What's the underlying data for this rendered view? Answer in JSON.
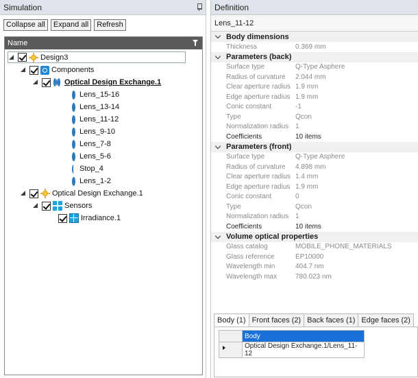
{
  "simulation": {
    "title": "Simulation",
    "toolbar": {
      "collapse_all": "Collapse all",
      "expand_all": "Expand all",
      "refresh": "Refresh"
    },
    "tree_header": "Name",
    "tree": [
      {
        "label": "Design3"
      },
      {
        "label": "Components"
      },
      {
        "label": "Optical Design Exchange.1"
      },
      {
        "label": "Lens_15-16"
      },
      {
        "label": "Lens_13-14"
      },
      {
        "label": "Lens_11-12"
      },
      {
        "label": "Lens_9-10"
      },
      {
        "label": "Lens_7-8"
      },
      {
        "label": "Lens_5-6"
      },
      {
        "label": "Stop_4"
      },
      {
        "label": "Lens_1-2"
      },
      {
        "label": "Optical Design Exchange.1"
      },
      {
        "label": "Sensors"
      },
      {
        "label": "Irradiance.1"
      }
    ]
  },
  "definition": {
    "title": "Definition",
    "object_name": "Lens_11-12",
    "categories": [
      {
        "label": "Body dimensions",
        "rows": [
          {
            "name": "Thickness",
            "value": "0.369 mm"
          }
        ]
      },
      {
        "label": "Parameters (back)",
        "rows": [
          {
            "name": "Surface type",
            "value": "Q-Type Asphere"
          },
          {
            "name": "Radius of curvature",
            "value": "2.044 mm"
          },
          {
            "name": "Clear aperture radius",
            "value": "1.9 mm"
          },
          {
            "name": "Edge aperture radius",
            "value": "1.9 mm"
          },
          {
            "name": "Conic constant",
            "value": "-1"
          },
          {
            "name": "Type",
            "value": "Qcon"
          },
          {
            "name": "Normalization radius",
            "value": "1"
          },
          {
            "name": "Coefficients",
            "value": "10 items"
          }
        ]
      },
      {
        "label": "Parameters (front)",
        "rows": [
          {
            "name": "Surface type",
            "value": "Q-Type Asphere"
          },
          {
            "name": "Radius of curvature",
            "value": "4.898 mm"
          },
          {
            "name": "Clear aperture radius",
            "value": "1.4 mm"
          },
          {
            "name": "Edge aperture radius",
            "value": "1.9 mm"
          },
          {
            "name": "Conic constant",
            "value": "0"
          },
          {
            "name": "Type",
            "value": "Qcon"
          },
          {
            "name": "Normalization radius",
            "value": "1"
          },
          {
            "name": "Coefficients",
            "value": "10 items"
          }
        ]
      },
      {
        "label": "Volume optical properties",
        "rows": [
          {
            "name": "Glass catalog",
            "value": "MOBILE_PHONE_MATERIALS"
          },
          {
            "name": "Glass reference",
            "value": "EP10000"
          },
          {
            "name": "Wavelength min",
            "value": "404.7 nm"
          },
          {
            "name": "Wavelength max",
            "value": "780.023 nm"
          }
        ]
      }
    ],
    "tabs": [
      "Body (1)",
      "Front faces (2)",
      "Back faces (1)",
      "Edge faces (2)"
    ],
    "grid": {
      "header": "Body",
      "row": "Optical Design Exchange.1/Lens_11-12"
    }
  }
}
